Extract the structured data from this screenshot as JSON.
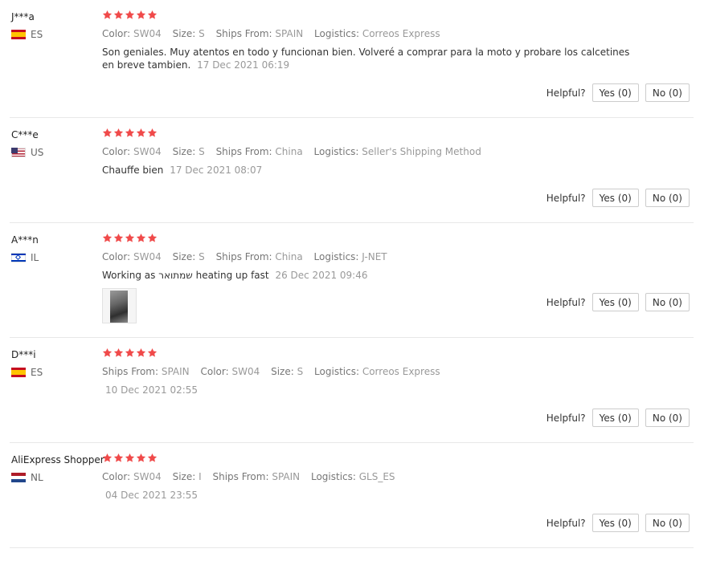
{
  "reviews": [
    {
      "user": "J***a",
      "country": "ES",
      "flag": "es",
      "stars": 5,
      "attrs": [
        {
          "label": "Color:",
          "value": "SW04"
        },
        {
          "label": "Size:",
          "value": "S"
        },
        {
          "label": "Ships From:",
          "value": "SPAIN"
        },
        {
          "label": "Logistics:",
          "value": "Correos Express"
        }
      ],
      "text": "Son geniales. Muy atentos en todo y funcionan bien. Volveré a comprar para la moto y probare los calcetines en breve tambien.",
      "date": "17 Dec 2021 06:19",
      "helpful_label": "Helpful?",
      "yes_label": "Yes (0)",
      "no_label": "No (0)"
    },
    {
      "user": "C***e",
      "country": "US",
      "flag": "us",
      "stars": 5,
      "attrs": [
        {
          "label": "Color:",
          "value": "SW04"
        },
        {
          "label": "Size:",
          "value": "S"
        },
        {
          "label": "Ships From:",
          "value": "China"
        },
        {
          "label": "Logistics:",
          "value": "Seller's Shipping Method"
        }
      ],
      "text": "Chauffe bien",
      "date": "17 Dec 2021 08:07",
      "helpful_label": "Helpful?",
      "yes_label": "Yes (0)",
      "no_label": "No (0)"
    },
    {
      "user": "A***n",
      "country": "IL",
      "flag": "il",
      "stars": 5,
      "attrs": [
        {
          "label": "Color:",
          "value": "SW04"
        },
        {
          "label": "Size:",
          "value": "S"
        },
        {
          "label": "Ships From:",
          "value": "China"
        },
        {
          "label": "Logistics:",
          "value": "J-NET"
        }
      ],
      "text": "Working as שמתואר heating up fast",
      "date": "26 Dec 2021 09:46",
      "has_photo": true,
      "helpful_label": "Helpful?",
      "yes_label": "Yes (0)",
      "no_label": "No (0)"
    },
    {
      "user": "D***i",
      "country": "ES",
      "flag": "es",
      "stars": 5,
      "attrs": [
        {
          "label": "Ships From:",
          "value": "SPAIN"
        },
        {
          "label": "Color:",
          "value": "SW04"
        },
        {
          "label": "Size:",
          "value": "S"
        },
        {
          "label": "Logistics:",
          "value": "Correos Express"
        }
      ],
      "text": "",
      "date": "10 Dec 2021 02:55",
      "helpful_label": "Helpful?",
      "yes_label": "Yes (0)",
      "no_label": "No (0)"
    },
    {
      "user": "AliExpress Shopper",
      "country": "NL",
      "flag": "nl",
      "stars": 5,
      "attrs": [
        {
          "label": "Color:",
          "value": "SW04"
        },
        {
          "label": "Size:",
          "value": "I"
        },
        {
          "label": "Ships From:",
          "value": "SPAIN"
        },
        {
          "label": "Logistics:",
          "value": "GLS_ES"
        }
      ],
      "text": "",
      "date": "04 Dec 2021 23:55",
      "helpful_label": "Helpful?",
      "yes_label": "Yes (0)",
      "no_label": "No (0)"
    }
  ],
  "colors": {
    "star": "#f04a4a",
    "border": "#e8e8e8"
  }
}
